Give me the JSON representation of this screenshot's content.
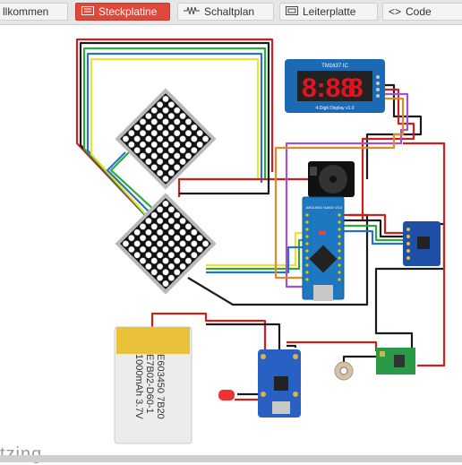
{
  "tabs": [
    {
      "label": "llkommen",
      "active": false,
      "icon": "none"
    },
    {
      "label": "Steckplatine",
      "active": true,
      "icon": "breadboard-icon"
    },
    {
      "label": "Schaltplan",
      "active": false,
      "icon": "schematic-icon"
    },
    {
      "label": "Leiterplatte",
      "active": false,
      "icon": "pcb-icon"
    },
    {
      "label": "Code",
      "active": false,
      "icon": "code-icon"
    }
  ],
  "components": {
    "display": {
      "label": "TM1637 IC",
      "subtitle": "4-Digit Display  v1.0",
      "digits": "8:88",
      "digit_last": "8"
    },
    "arduino": {
      "label": "ARDUINO NANO V3.0"
    },
    "battery": {
      "line1": "E603450 7B20",
      "line2": "E7B02-D60-1",
      "line3": "1000mAh 3.7V"
    }
  },
  "brand": {
    "text": "tzing"
  },
  "colors": {
    "active_tab": "#e0483b",
    "wire_red": "#cc1f1f",
    "wire_black": "#1a1a1a",
    "wire_yellow": "#f0e030",
    "wire_green": "#2eaa3a",
    "wire_blue": "#2a6fd0",
    "wire_purple": "#a056c8",
    "wire_orange": "#e08a2a"
  }
}
